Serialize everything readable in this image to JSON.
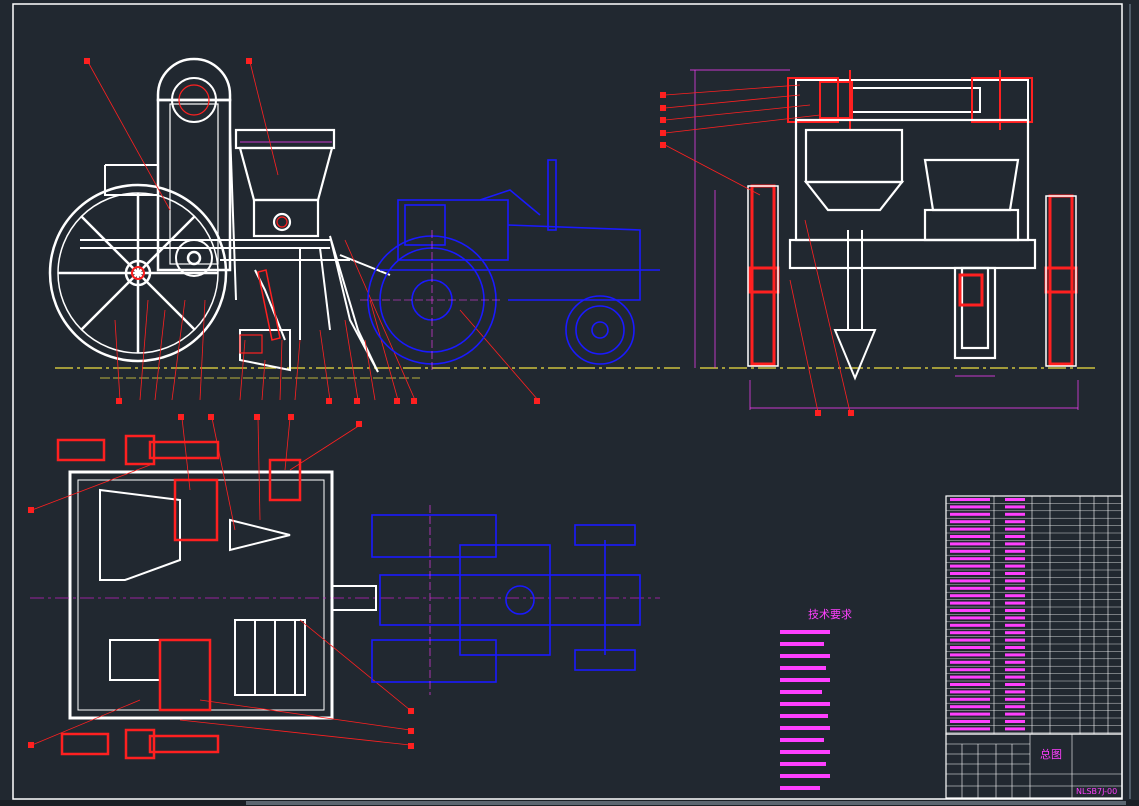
{
  "colors": {
    "background": "#212830",
    "frame": "#ffffff",
    "part_red": "#ff2020",
    "tractor_blue": "#1a1aff",
    "dimension_magenta": "#ff3fff",
    "ground_yellow": "#f0e040",
    "centerline_magenta": "#c020c0"
  },
  "notes": {
    "heading": "技术要求"
  },
  "title_block": {
    "drawing_name": "总图",
    "drawing_number": "NLSB7J-00"
  }
}
